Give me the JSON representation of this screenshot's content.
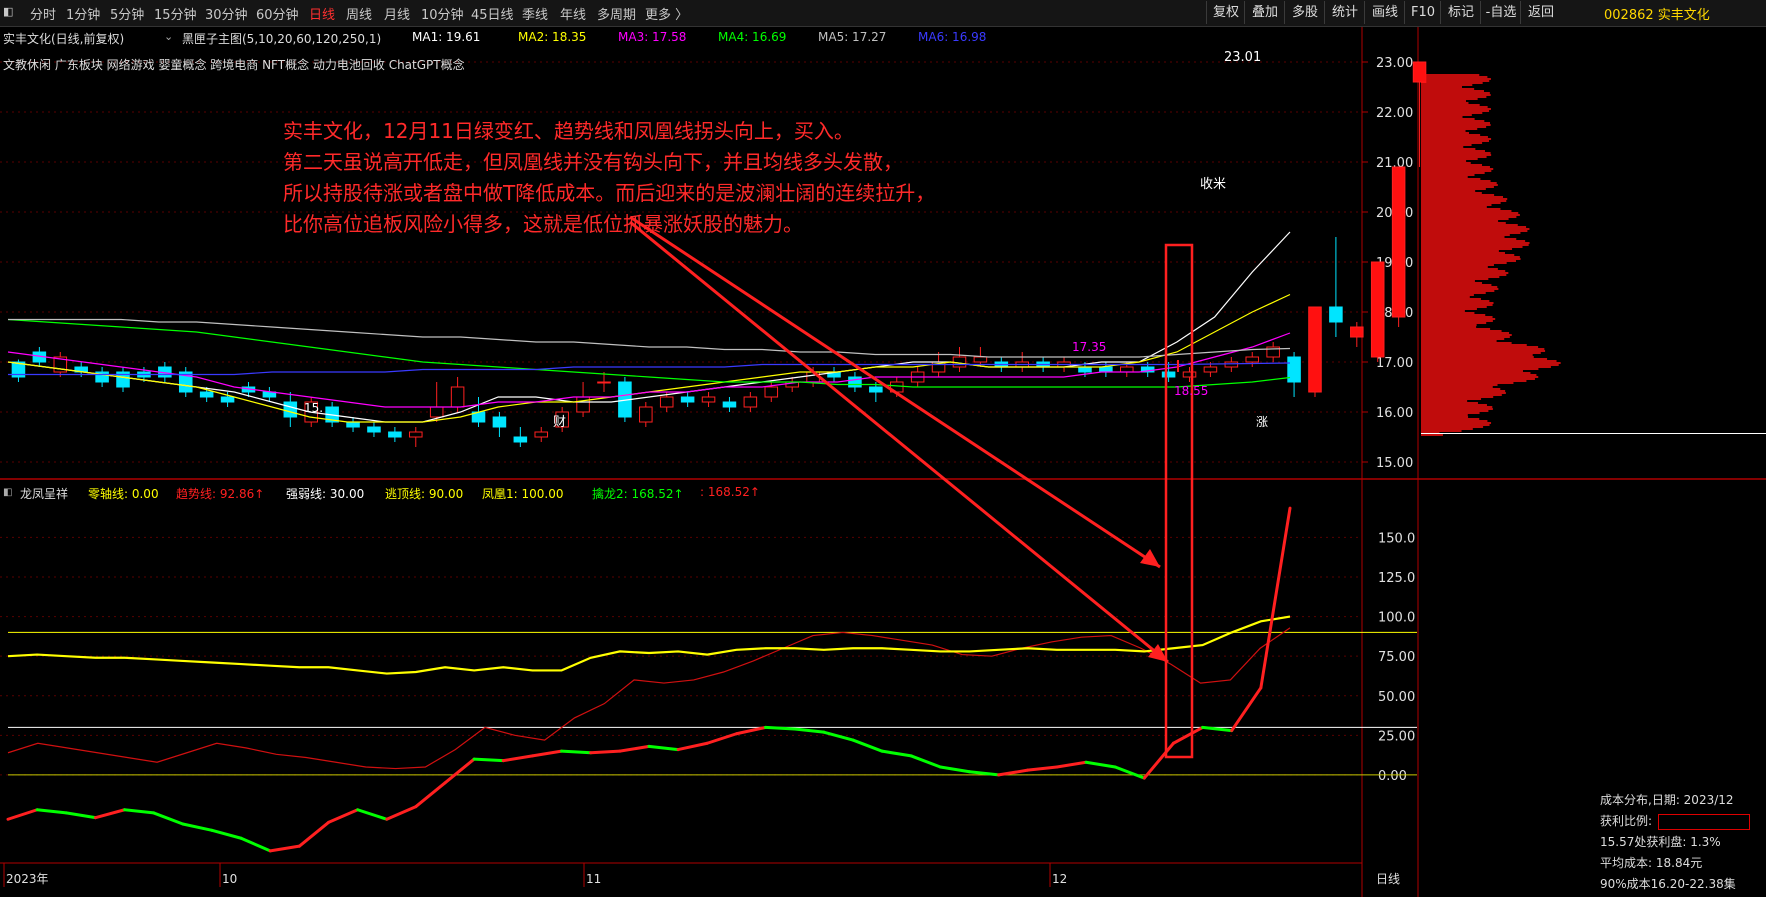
{
  "toolbar": {
    "periods": [
      "分时",
      "1分钟",
      "5分钟",
      "15分钟",
      "30分钟",
      "60分钟",
      "日线",
      "周线",
      "月线",
      "10分钟",
      "45日线",
      "季线",
      "年线",
      "多周期",
      "更多 〉"
    ],
    "active": "日线",
    "right_buttons": [
      "复权",
      "叠加",
      "多股",
      "统计",
      "画线",
      "F10",
      "标记",
      "-自选",
      "返回"
    ],
    "stock_code": "002862 实丰文化"
  },
  "main_chart": {
    "title": "实丰文化(日线,前复权)",
    "indicator_name": "黑匣子主图(5,10,20,60,120,250,1)",
    "ma": [
      {
        "label": "MA1: 19.61",
        "color": "#ffffff"
      },
      {
        "label": "MA2: 18.35",
        "color": "#ffff00"
      },
      {
        "label": "MA3: 17.58",
        "color": "#ff00ff"
      },
      {
        "label": "MA4: 16.69",
        "color": "#00ff00"
      },
      {
        "label": "MA5: 17.27",
        "color": "#c0c0c0"
      },
      {
        "label": "MA6: 16.98",
        "color": "#3a3aff"
      }
    ],
    "concepts": "文教休闲 广东板块 网络游戏 婴童概念 跨境电商 NFT概念 动力电池回收 ChatGPT概念",
    "price_axis": [
      "23.00",
      "22.00",
      "21.00",
      "20.00",
      "19.00",
      "18.00",
      "17.00",
      "16.00",
      "15.00"
    ],
    "high_label": "23.01",
    "low_label": "15.",
    "shoumi_label": "收米",
    "up_label_1": "17.35",
    "up_label_2": "18.55",
    "cai_label": "财",
    "zhang_label": "涨"
  },
  "annotation": {
    "lines": [
      "实丰文化，12月11日绿变红、趋势线和凤凰线拐头向上，买入。",
      "第二天虽说高开低走，但凤凰线并没有钩头向下，并且均线多头发散，",
      "所以持股待涨或者盘中做T降低成本。而后迎来的是波澜壮阔的连续拉升，",
      "比你高位追板风险小得多，这就是低位抓暴涨妖股的魅力。"
    ]
  },
  "sub_chart": {
    "name": "龙凤呈祥",
    "labels": [
      {
        "text": "零轴线: 0.00",
        "color": "#ffff00"
      },
      {
        "text": "趋势线: 92.86↑",
        "color": "#ff2020"
      },
      {
        "text": "强弱线: 30.00",
        "color": "#ffffff"
      },
      {
        "text": "逃顶线: 90.00",
        "color": "#ffff00"
      },
      {
        "text": "凤凰1: 100.00",
        "color": "#ffff00"
      },
      {
        "text": "擒龙2: 168.52↑",
        "color": "#00ff00"
      },
      {
        "text": ": 168.52↑",
        "color": "#ff2020"
      }
    ],
    "axis": [
      "150.0",
      "125.0",
      "100.0",
      "75.00",
      "50.00",
      "25.00",
      "0.00"
    ]
  },
  "time_axis": {
    "labels": [
      "2023年",
      "10",
      "11",
      "12"
    ],
    "period": "日线"
  },
  "cost_panel": {
    "title": "成本分布,日期: 2023/12",
    "profit_label": "获利比例:",
    "line1": "15.57处获利盘: 1.3%",
    "line2": "平均成本: 18.84元",
    "line3": "90%成本16.20-22.38集"
  },
  "chart_data": {
    "type": "candlestick",
    "price_range": [
      14.7,
      23.3
    ],
    "indicator_range": [
      -55,
      185
    ],
    "candles": [
      [
        17.0,
        16.7,
        17.05,
        16.6
      ],
      [
        17.2,
        17.0,
        17.3,
        16.9
      ],
      [
        16.8,
        17.1,
        17.2,
        16.7
      ],
      [
        16.9,
        16.8,
        17.0,
        16.7
      ],
      [
        16.8,
        16.6,
        16.9,
        16.5
      ],
      [
        16.8,
        16.5,
        16.9,
        16.4
      ],
      [
        16.8,
        16.7,
        16.9,
        16.6
      ],
      [
        16.9,
        16.7,
        17.0,
        16.6
      ],
      [
        16.8,
        16.4,
        16.9,
        16.3
      ],
      [
        16.4,
        16.3,
        16.5,
        16.2
      ],
      [
        16.3,
        16.2,
        16.4,
        16.1
      ],
      [
        16.5,
        16.4,
        16.6,
        16.3
      ],
      [
        16.4,
        16.3,
        16.5,
        16.2
      ],
      [
        16.2,
        15.9,
        16.4,
        15.7
      ],
      [
        15.8,
        16.2,
        16.3,
        15.7
      ],
      [
        16.1,
        15.8,
        16.2,
        15.7
      ],
      [
        15.8,
        15.7,
        15.9,
        15.6
      ],
      [
        15.7,
        15.6,
        15.8,
        15.5
      ],
      [
        15.6,
        15.5,
        15.7,
        15.4
      ],
      [
        15.5,
        15.6,
        15.7,
        15.3
      ],
      [
        15.9,
        16.1,
        16.6,
        15.8
      ],
      [
        16.1,
        16.5,
        16.7,
        16.0
      ],
      [
        16.0,
        15.8,
        16.3,
        15.7
      ],
      [
        15.9,
        15.7,
        16.0,
        15.5
      ],
      [
        15.5,
        15.4,
        15.7,
        15.3
      ],
      [
        15.5,
        15.6,
        15.7,
        15.4
      ],
      [
        15.7,
        16.0,
        16.1,
        15.6
      ],
      [
        16.0,
        16.3,
        16.6,
        15.9
      ],
      [
        16.6,
        16.6,
        16.8,
        16.4
      ],
      [
        16.6,
        15.9,
        16.7,
        15.8
      ],
      [
        15.8,
        16.1,
        16.2,
        15.7
      ],
      [
        16.1,
        16.3,
        16.4,
        16.0
      ],
      [
        16.3,
        16.2,
        16.4,
        16.1
      ],
      [
        16.2,
        16.3,
        16.4,
        16.1
      ],
      [
        16.2,
        16.1,
        16.3,
        16.0
      ],
      [
        16.1,
        16.3,
        16.4,
        16.0
      ],
      [
        16.3,
        16.5,
        16.6,
        16.2
      ],
      [
        16.5,
        16.6,
        16.7,
        16.4
      ],
      [
        16.6,
        16.8,
        16.9,
        16.5
      ],
      [
        16.8,
        16.7,
        16.9,
        16.6
      ],
      [
        16.7,
        16.5,
        16.8,
        16.4
      ],
      [
        16.5,
        16.4,
        16.6,
        16.2
      ],
      [
        16.4,
        16.6,
        16.7,
        16.3
      ],
      [
        16.6,
        16.8,
        16.9,
        16.5
      ],
      [
        16.8,
        17.0,
        17.2,
        16.7
      ],
      [
        16.9,
        17.1,
        17.3,
        16.8
      ],
      [
        17.0,
        17.1,
        17.3,
        16.9
      ],
      [
        17.0,
        16.9,
        17.1,
        16.8
      ],
      [
        16.9,
        17.0,
        17.2,
        16.8
      ],
      [
        17.0,
        16.9,
        17.1,
        16.8
      ],
      [
        16.9,
        17.0,
        17.1,
        16.8
      ],
      [
        16.9,
        16.8,
        17.0,
        16.7
      ],
      [
        16.9,
        16.8,
        17.0,
        16.7
      ],
      [
        16.8,
        16.9,
        17.0,
        16.7
      ],
      [
        16.9,
        16.8,
        17.0,
        16.7
      ],
      [
        16.8,
        16.7,
        17.0,
        16.6
      ],
      [
        16.7,
        16.8,
        16.9,
        16.6
      ],
      [
        16.8,
        16.9,
        17.0,
        16.7
      ],
      [
        16.9,
        17.0,
        17.1,
        16.8
      ],
      [
        17.0,
        17.1,
        17.2,
        16.9
      ],
      [
        17.1,
        17.3,
        17.4,
        17.0
      ],
      [
        17.1,
        16.6,
        17.2,
        16.3
      ],
      [
        16.4,
        18.1,
        18.1,
        16.3
      ],
      [
        18.1,
        17.8,
        19.5,
        17.5
      ],
      [
        17.5,
        17.7,
        17.8,
        17.3
      ],
      [
        17.1,
        19.0,
        19.0,
        17.0
      ],
      [
        17.9,
        20.9,
        20.9,
        17.7
      ],
      [
        22.6,
        23.0,
        23.0,
        20.9
      ]
    ],
    "ma_series": [
      {
        "name": "MA1",
        "color": "#ffffff",
        "values": [
          17.0,
          16.9,
          16.8,
          16.7,
          16.6,
          16.5,
          16.4,
          16.2,
          16.0,
          15.9,
          15.8,
          15.8,
          16.0,
          16.3,
          16.3,
          16.2,
          16.2,
          16.3,
          16.4,
          16.5,
          16.6,
          16.7,
          16.8,
          16.9,
          17.0,
          17.0,
          16.9,
          16.9,
          16.9,
          17.0,
          17.0,
          17.4,
          17.9,
          18.8,
          19.6
        ]
      },
      {
        "name": "MA2",
        "color": "#ffff00",
        "values": [
          17.0,
          16.9,
          16.8,
          16.7,
          16.6,
          16.5,
          16.3,
          16.1,
          15.9,
          15.8,
          15.8,
          15.8,
          15.9,
          16.1,
          16.2,
          16.2,
          16.3,
          16.4,
          16.5,
          16.6,
          16.7,
          16.8,
          16.8,
          16.9,
          16.9,
          17.0,
          16.9,
          16.9,
          16.9,
          16.9,
          17.0,
          17.2,
          17.6,
          18.0,
          18.35
        ]
      },
      {
        "name": "MA3",
        "color": "#ff00ff",
        "values": [
          17.2,
          17.1,
          17.0,
          16.9,
          16.8,
          16.7,
          16.5,
          16.4,
          16.3,
          16.2,
          16.1,
          16.1,
          16.1,
          16.2,
          16.2,
          16.3,
          16.3,
          16.4,
          16.4,
          16.5,
          16.5,
          16.6,
          16.6,
          16.7,
          16.7,
          16.7,
          16.7,
          16.7,
          16.7,
          16.8,
          16.8,
          16.9,
          17.1,
          17.3,
          17.58
        ]
      },
      {
        "name": "MA4",
        "color": "#00ff00",
        "values": [
          17.85,
          17.8,
          17.75,
          17.7,
          17.65,
          17.6,
          17.5,
          17.4,
          17.3,
          17.2,
          17.1,
          17.0,
          16.95,
          16.9,
          16.85,
          16.8,
          16.75,
          16.7,
          16.65,
          16.6,
          16.6,
          16.6,
          16.55,
          16.55,
          16.5,
          16.5,
          16.5,
          16.5,
          16.5,
          16.5,
          16.5,
          16.5,
          16.55,
          16.6,
          16.69
        ]
      },
      {
        "name": "MA5",
        "color": "#c0c0c0",
        "values": [
          17.85,
          17.85,
          17.85,
          17.85,
          17.8,
          17.8,
          17.75,
          17.7,
          17.65,
          17.6,
          17.55,
          17.5,
          17.5,
          17.45,
          17.4,
          17.4,
          17.35,
          17.3,
          17.3,
          17.25,
          17.25,
          17.2,
          17.2,
          17.15,
          17.15,
          17.15,
          17.1,
          17.1,
          17.1,
          17.1,
          17.1,
          17.15,
          17.2,
          17.25,
          17.27
        ]
      },
      {
        "name": "MA6",
        "color": "#3a3aff",
        "values": [
          16.75,
          16.75,
          16.75,
          16.75,
          16.75,
          16.75,
          16.75,
          16.8,
          16.8,
          16.8,
          16.8,
          16.85,
          16.85,
          16.85,
          16.85,
          16.9,
          16.9,
          16.9,
          16.9,
          16.9,
          16.95,
          16.95,
          16.95,
          16.95,
          16.95,
          16.95,
          16.95,
          16.95,
          16.95,
          16.95,
          16.95,
          16.95,
          16.96,
          16.97,
          16.98
        ]
      }
    ],
    "trend_line": [
      14,
      20,
      17,
      14,
      11,
      8,
      14,
      20,
      17,
      13,
      11,
      8,
      5,
      4,
      5,
      16,
      30,
      25,
      22,
      36,
      45,
      60,
      58,
      60,
      65,
      72,
      80,
      88,
      90,
      88,
      85,
      82,
      76,
      75,
      80,
      84,
      87,
      88,
      80,
      70,
      58,
      60,
      80,
      92.86
    ],
    "phoenix_line": [
      75,
      76,
      75,
      74,
      74,
      73,
      72,
      71,
      70,
      69,
      68,
      68,
      66,
      64,
      65,
      68,
      66,
      68,
      66,
      66,
      74,
      78,
      77,
      78,
      76,
      79,
      80,
      80,
      79,
      80,
      80,
      79,
      78,
      78,
      79,
      80,
      79,
      79,
      79,
      78,
      80,
      82,
      90,
      97,
      100
    ],
    "dragon_line": [
      -28,
      -22,
      -24,
      -27,
      -22,
      -24,
      -31,
      -35,
      -40,
      -48,
      -45,
      -30,
      -22,
      -28,
      -20,
      -5,
      10,
      9,
      12,
      15,
      14,
      15,
      18,
      16,
      20,
      26,
      30,
      29,
      27,
      22,
      15,
      12,
      5,
      2,
      0,
      3,
      5,
      8,
      5,
      -2,
      20,
      30,
      28,
      55,
      168.52
    ]
  }
}
